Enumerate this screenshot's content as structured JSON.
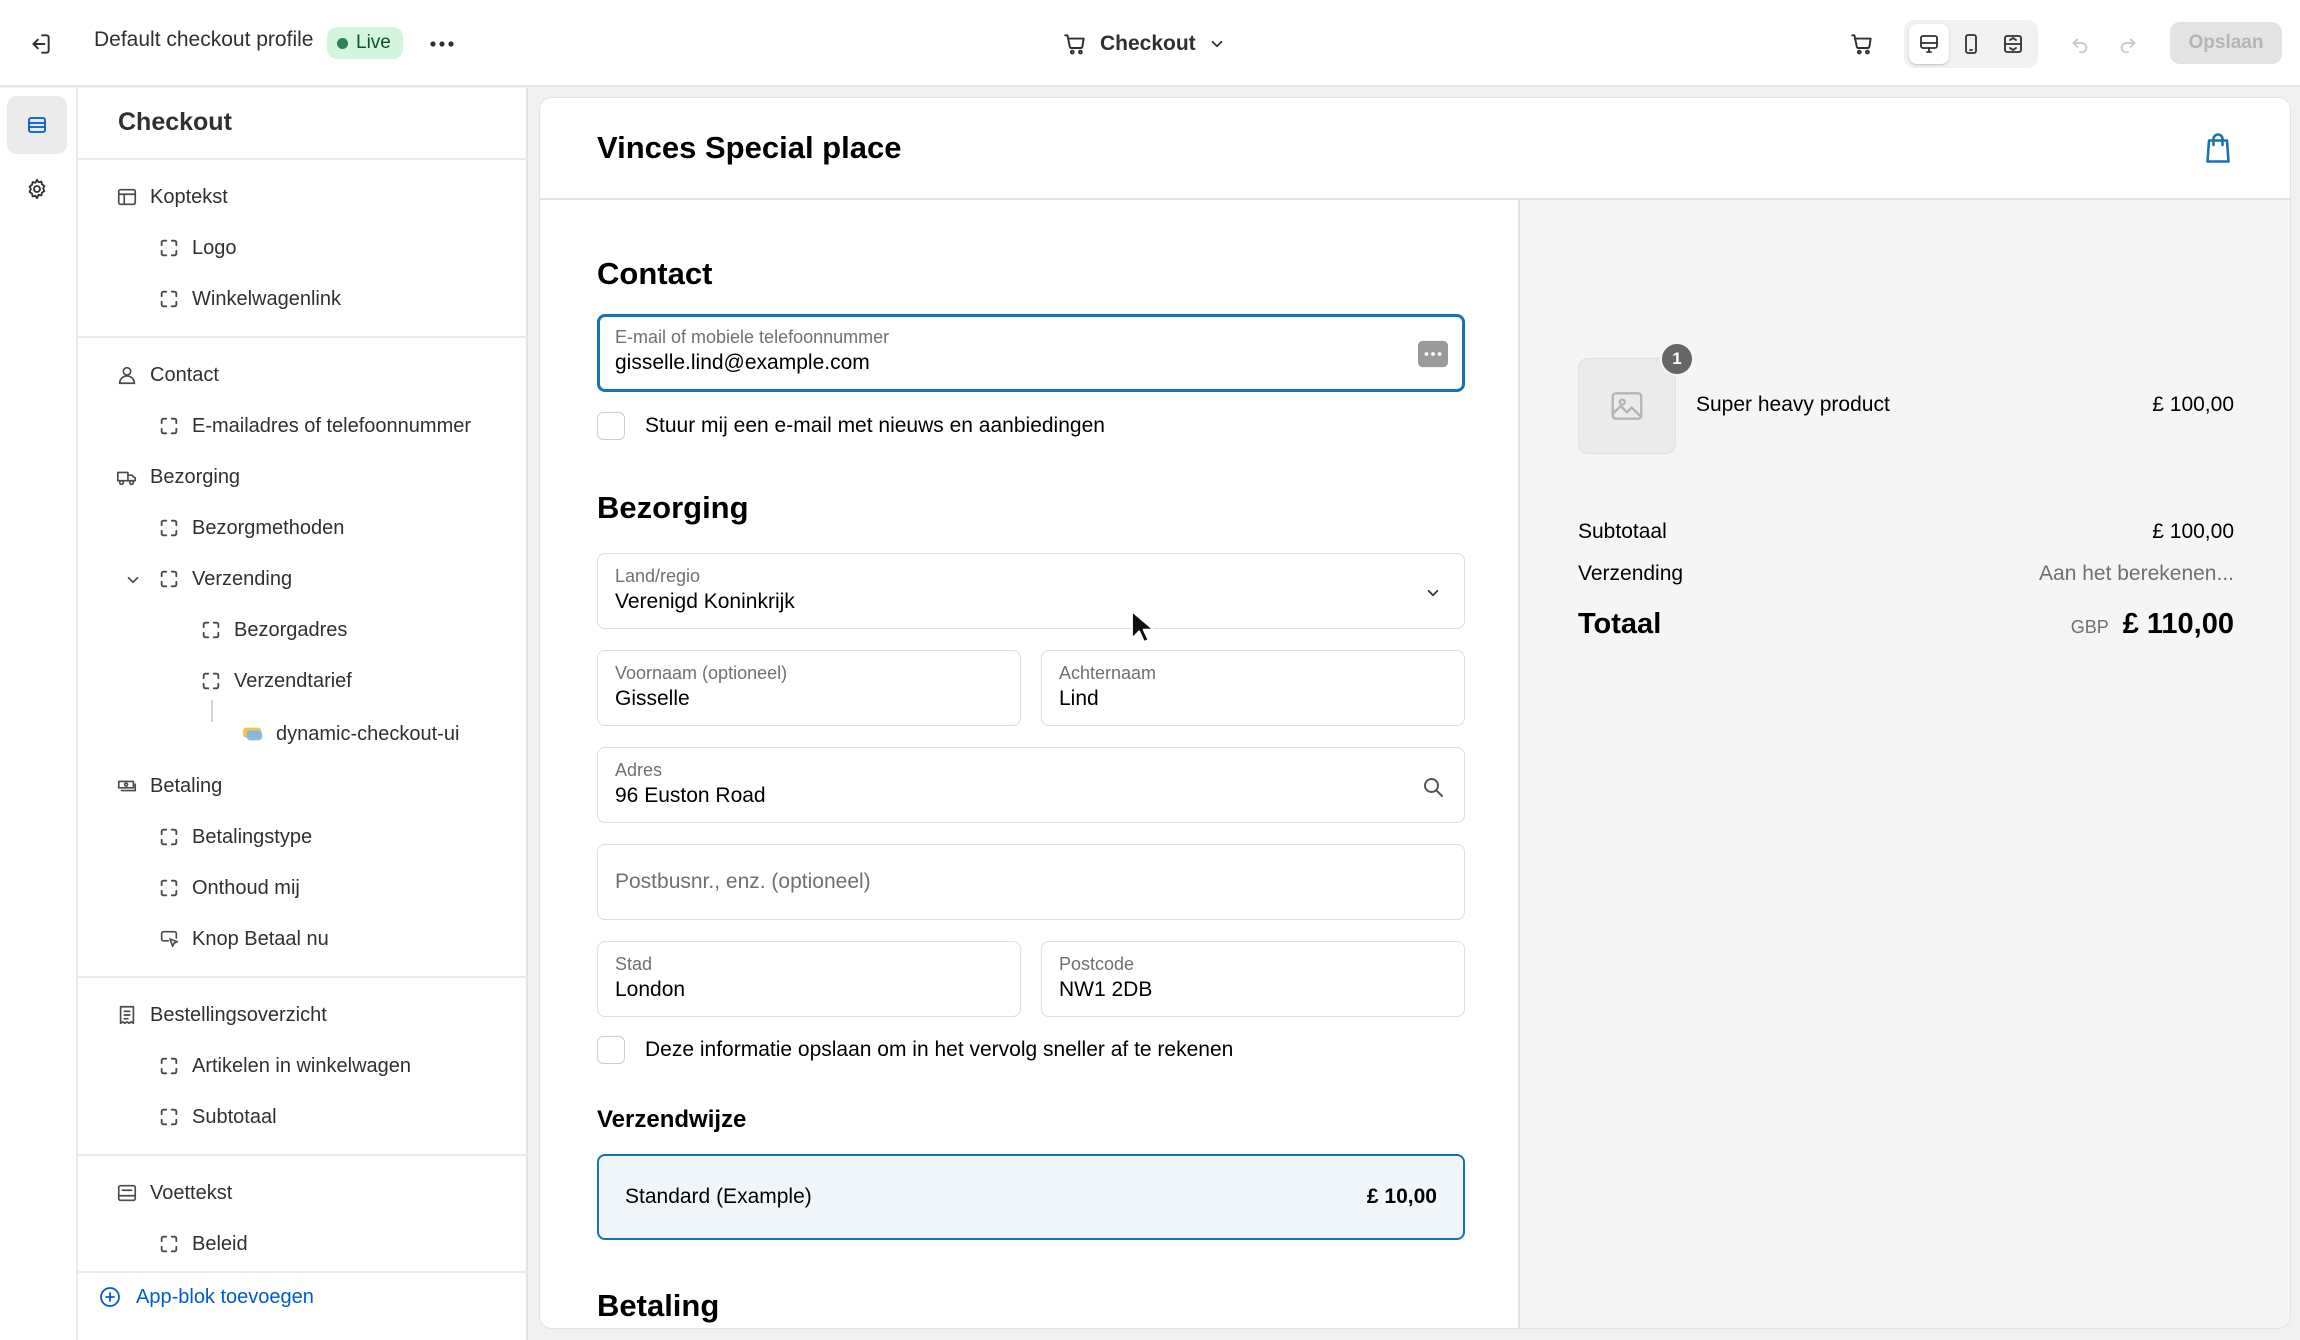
{
  "topbar": {
    "profile_name": "Default checkout profile",
    "live_badge": "Live",
    "page_select": "Checkout",
    "save_label": "Opslaan"
  },
  "sidebar": {
    "title": "Checkout",
    "items": [
      {
        "label": "Koptekst"
      },
      {
        "label": "Logo"
      },
      {
        "label": "Winkelwagenlink"
      },
      {
        "label": "Contact"
      },
      {
        "label": "E-mailadres of telefoonnummer"
      },
      {
        "label": "Bezorging"
      },
      {
        "label": "Bezorgmethoden"
      },
      {
        "label": "Verzending"
      },
      {
        "label": "Bezorgadres"
      },
      {
        "label": "Verzendtarief"
      },
      {
        "label": "dynamic-checkout-ui"
      },
      {
        "label": "Betaling"
      },
      {
        "label": "Betalingstype"
      },
      {
        "label": "Onthoud mij"
      },
      {
        "label": "Knop Betaal nu"
      },
      {
        "label": "Bestellingsoverzicht"
      },
      {
        "label": "Artikelen in winkelwagen"
      },
      {
        "label": "Subtotaal"
      },
      {
        "label": "Voettekst"
      },
      {
        "label": "Beleid"
      }
    ],
    "add_app_block": "App-blok toevoegen"
  },
  "preview": {
    "shop_name": "Vinces Special place",
    "contact": {
      "heading": "Contact",
      "email_label": "E-mail of mobiele telefoonnummer",
      "email_value": "gisselle.lind@example.com",
      "newsletter_label": "Stuur mij een e-mail met nieuws en aanbiedingen"
    },
    "delivery": {
      "heading": "Bezorging",
      "country_label": "Land/regio",
      "country_value": "Verenigd Koninkrijk",
      "first_name_label": "Voornaam (optioneel)",
      "first_name_value": "Gisselle",
      "last_name_label": "Achternaam",
      "last_name_value": "Lind",
      "address_label": "Adres",
      "address_value": "96 Euston Road",
      "address2_placeholder": "Postbusnr., enz. (optioneel)",
      "city_label": "Stad",
      "city_value": "London",
      "postcode_label": "Postcode",
      "postcode_value": "NW1 2DB",
      "save_info_label": "Deze informatie opslaan om in het vervolg sneller af te rekenen"
    },
    "shipping_method": {
      "heading": "Verzendwijze",
      "option_name": "Standard (Example)",
      "option_price": "£ 10,00"
    },
    "payment": {
      "heading": "Betaling"
    },
    "summary": {
      "product_name": "Super heavy product",
      "product_price": "£ 100,00",
      "quantity": "1",
      "subtotal_label": "Subtotaal",
      "subtotal_value": "£ 100,00",
      "shipping_label": "Verzending",
      "shipping_value": "Aan het berekenen...",
      "total_label": "Totaal",
      "total_currency": "GBP",
      "total_value": "£ 110,00"
    }
  },
  "colors": {
    "accent_blue": "#1773b0",
    "link_blue": "#005bd3",
    "live_green": "#29845a"
  }
}
